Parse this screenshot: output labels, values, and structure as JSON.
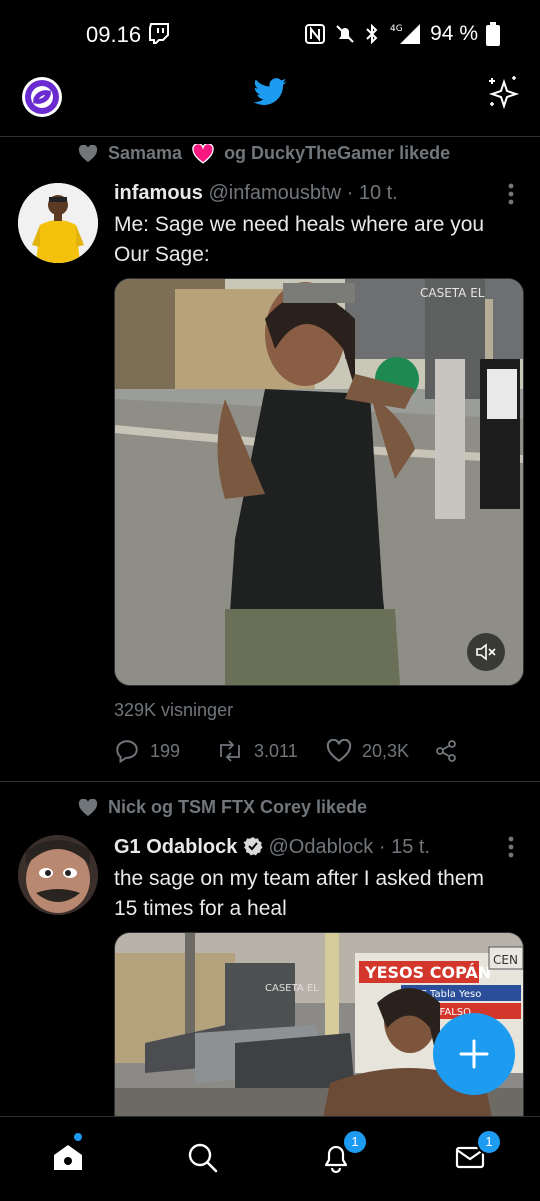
{
  "status_bar": {
    "time": "09.16",
    "network": "4G",
    "battery": "94 %"
  },
  "feed": [
    {
      "social_context": "Samama",
      "social_context_rest": "og DuckyTheGamer likede",
      "author_name": "infamous",
      "author_handle": "@infamousbtw",
      "time": "· 10 t.",
      "text_line1": "Me: Sage we need heals where are you",
      "text_line2": "Our Sage:",
      "media_sign": "CASETA EL",
      "views": "329K visninger",
      "replies": "199",
      "retweets": "3.011",
      "likes": "20,3K"
    },
    {
      "social_context": "Nick og TSM FTX Corey likede",
      "author_name": "G1 Odablock",
      "author_handle": "@Odablock",
      "time": "· 15 t.",
      "text_line1": "the sage on my team after I asked them",
      "text_line2": "15 times for a heal",
      "media_sign1": "YESOS COPÁN",
      "media_sign2": "CEN",
      "media_sign3": "CASETA EL",
      "media_sign4": "PVC  Tabla Yeso",
      "media_sign5": "CIELO FALSO"
    }
  ],
  "bottom_nav": {
    "notifications_badge": "1",
    "messages_badge": "1"
  },
  "colors": {
    "accent": "#1d9bf0",
    "background": "#000000",
    "muted": "#71767b",
    "like_red": "#f91880"
  }
}
